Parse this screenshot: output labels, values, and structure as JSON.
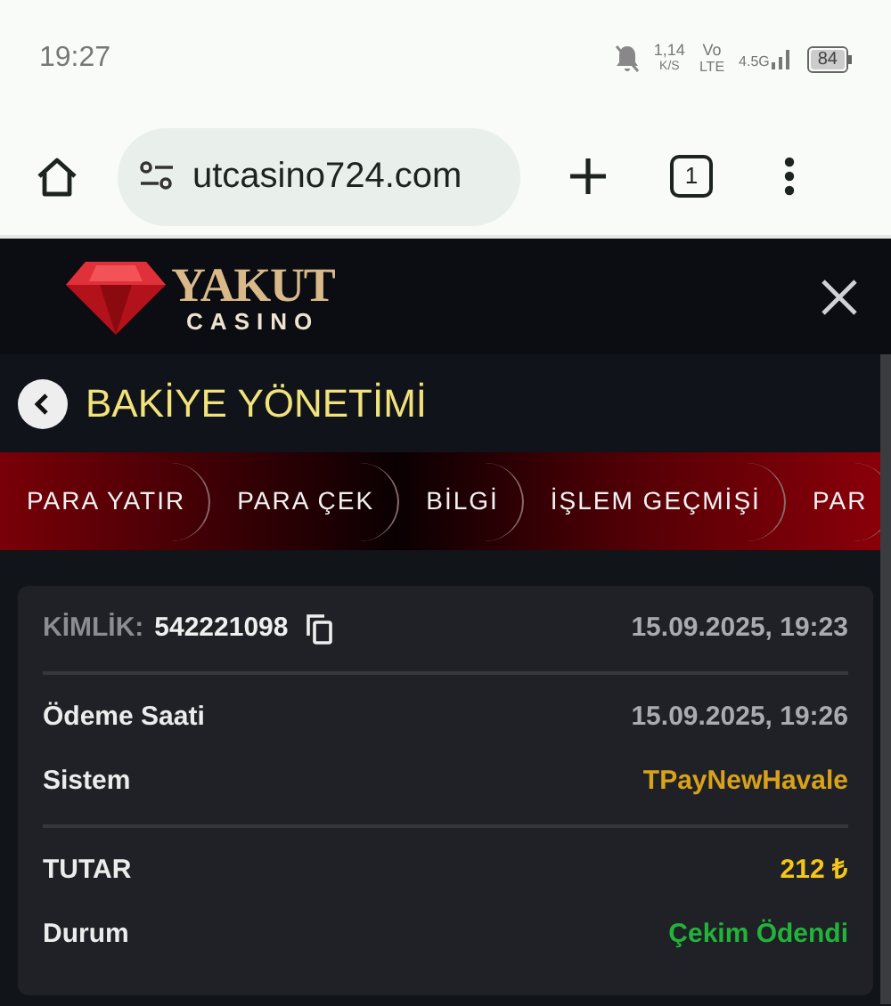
{
  "status_bar": {
    "time": "19:27",
    "speed": "1,14",
    "speed_unit": "K/S",
    "volte_top": "Vo",
    "volte_bottom": "LTE",
    "network": "4.5G",
    "battery": "84"
  },
  "browser": {
    "url": "utcasino724.com",
    "tab_count": "1"
  },
  "site_header": {
    "logo_top": "YAKUT",
    "logo_bottom": "CASINO"
  },
  "page_title": "BAKİYE YÖNETİMİ",
  "tabs": [
    {
      "label": "PARA YATIR"
    },
    {
      "label": "PARA ÇEK"
    },
    {
      "label": "BİLGİ"
    },
    {
      "label": "İŞLEM GEÇMİŞİ"
    },
    {
      "label": "PAR"
    }
  ],
  "transaction": {
    "id_label": "KİMLİK:",
    "id": "542221098",
    "created": "15.09.2025, 19:23",
    "sections": [
      [
        {
          "label": "Ödeme Saati",
          "value": "15.09.2025, 19:26",
          "color": "#a9abb0"
        },
        {
          "label": "Sistem",
          "value": "TPayNewHavale",
          "color": "#d9a21b"
        }
      ],
      [
        {
          "label": "TUTAR",
          "value": "212 ₺",
          "color": "#f5c518"
        },
        {
          "label": "Durum",
          "value": "Çekim Ödendi",
          "color": "#22b33a"
        }
      ]
    ]
  }
}
